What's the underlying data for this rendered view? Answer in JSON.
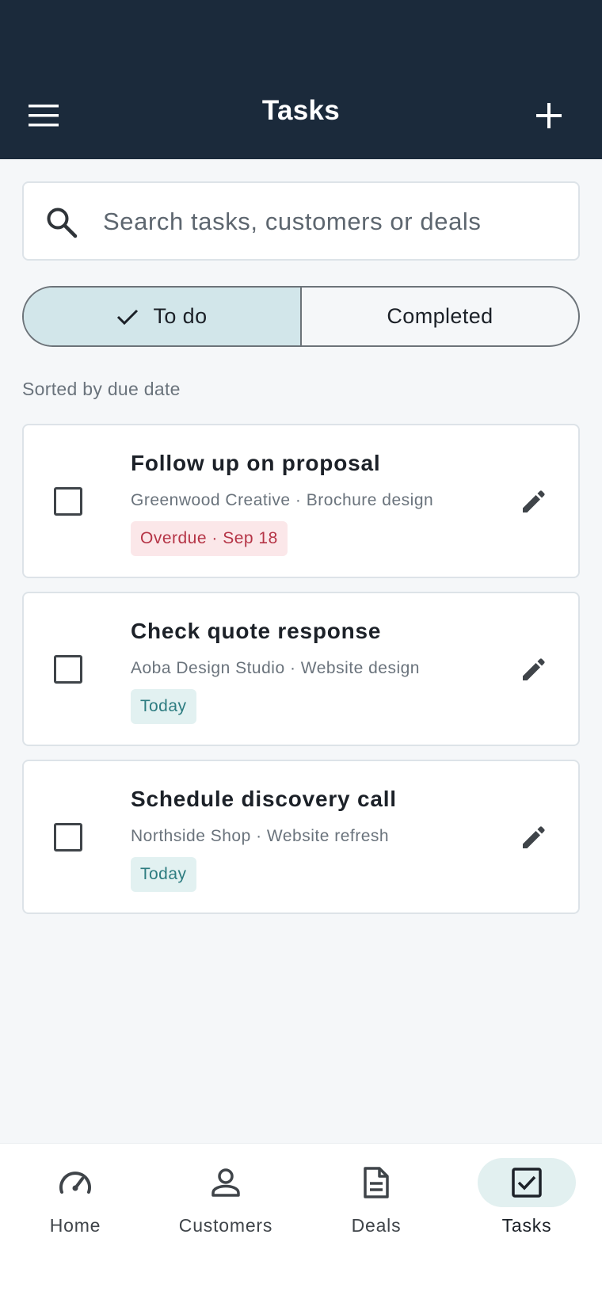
{
  "header": {
    "title": "Tasks",
    "menu_icon": "menu-icon",
    "add_icon": "plus-icon"
  },
  "search": {
    "placeholder": "Search tasks, customers or deals",
    "value": ""
  },
  "filter": {
    "todo_label": "To do",
    "completed_label": "Completed",
    "selected": "To do"
  },
  "sort_label": "Sorted by due date",
  "tasks": [
    {
      "title": "Follow up on proposal",
      "meta": "Greenwood Creative · Brochure design",
      "badge": "Overdue · Sep 18",
      "status": "overdue",
      "checked": false
    },
    {
      "title": "Check quote response",
      "meta": "Aoba Design Studio · Website design",
      "badge": "Today",
      "status": "today",
      "checked": false
    },
    {
      "title": "Schedule discovery call",
      "meta": "Northside Shop · Website refresh",
      "badge": "Today",
      "status": "today",
      "checked": false
    }
  ],
  "nav": {
    "items": [
      {
        "label": "Home",
        "icon": "speedometer-icon"
      },
      {
        "label": "Customers",
        "icon": "person-icon"
      },
      {
        "label": "Deals",
        "icon": "document-icon"
      },
      {
        "label": "Tasks",
        "icon": "check-square-icon"
      }
    ],
    "active": "Tasks"
  },
  "colors": {
    "header_bg": "#1b2a3b",
    "segment_active": "#d2e6ea",
    "overdue_text": "#b53446",
    "overdue_bg": "#fbe7e9",
    "today_text": "#2d7c80",
    "today_bg": "#e2f1f1"
  }
}
